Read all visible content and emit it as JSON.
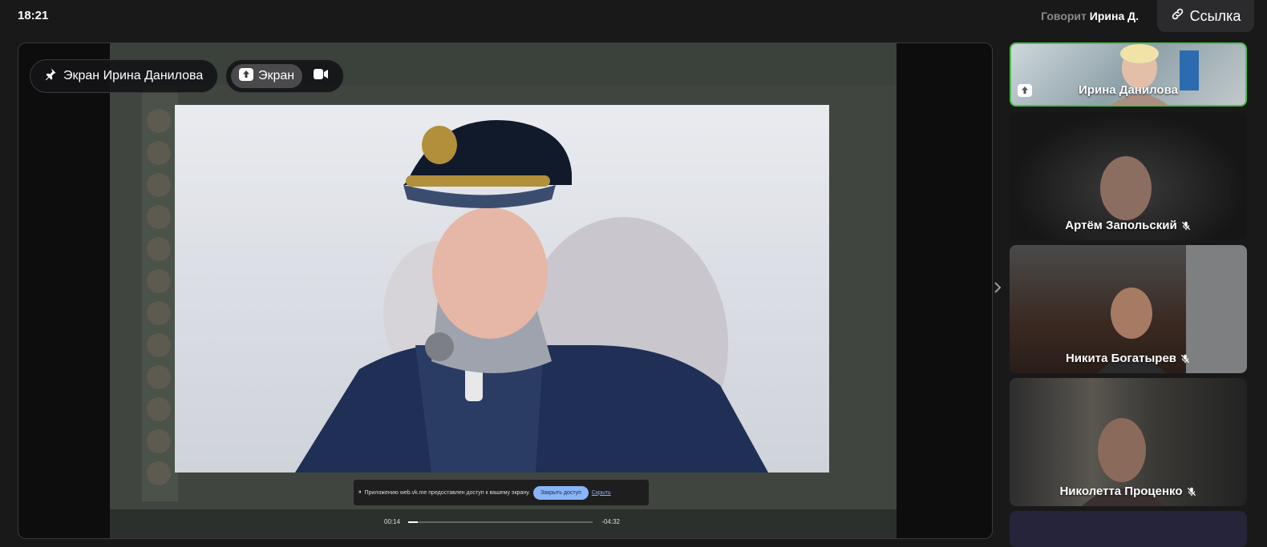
{
  "clock": "18:21",
  "speaking": {
    "prefix": "Говорит",
    "name": "Ирина Д."
  },
  "link_button": {
    "label": "Ссылка"
  },
  "stage": {
    "pin_label": "Экран Ирина Данилова",
    "mode_label": "Экран",
    "notify_text": "Приложению web.vk.me предоставлен доступ к вашему экрану.",
    "notify_share": "Закрыть доступ",
    "notify_hide": "Скрыть",
    "player_current": "00:14",
    "player_remaining": "-04:32",
    "player_progress": 0.05
  },
  "participants": [
    {
      "name": "Ирина Данилова",
      "speaking": true,
      "sharing": true,
      "muted": false
    },
    {
      "name": "Артём Запольский",
      "speaking": false,
      "sharing": false,
      "muted": true
    },
    {
      "name": "Никита Богатырев",
      "speaking": false,
      "sharing": false,
      "muted": true
    },
    {
      "name": "Николетта Проценко",
      "speaking": false,
      "sharing": false,
      "muted": true
    }
  ],
  "colors": {
    "speaker_border": "#4bbf4b",
    "accent_link": "#8ab4f8"
  },
  "icons": [
    "link-icon",
    "pin-icon",
    "screen-share-icon",
    "camera-icon",
    "mic-off-icon",
    "chevron-right-icon"
  ]
}
